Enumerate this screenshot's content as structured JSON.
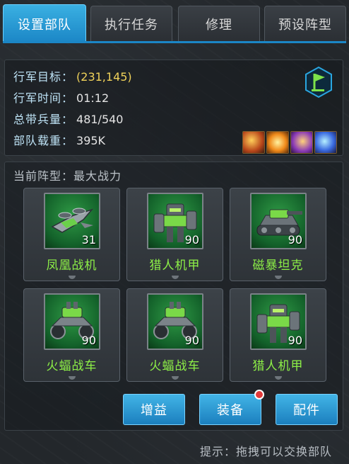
{
  "tabs": [
    {
      "label": "设置部队",
      "active": true
    },
    {
      "label": "执行任务",
      "active": false
    },
    {
      "label": "修理",
      "active": false
    },
    {
      "label": "预设阵型",
      "active": false
    }
  ],
  "info": {
    "target_label": "行军目标：",
    "target_value": "(231,145)",
    "time_label": "行军时间：",
    "time_value": "01:12",
    "troops_label": "总带兵量：",
    "troops_value": "481/540",
    "load_label": "部队载重：",
    "load_value": "395K"
  },
  "formation": {
    "title": "当前阵型：最大战力",
    "units": [
      {
        "name": "凤凰战机",
        "level": "31",
        "icon": "fighter-jet-icon"
      },
      {
        "name": "猎人机甲",
        "level": "90",
        "icon": "mech-icon"
      },
      {
        "name": "磁暴坦克",
        "level": "90",
        "icon": "tank-icon"
      },
      {
        "name": "火蝠战车",
        "level": "90",
        "icon": "buggy-icon"
      },
      {
        "name": "火蝠战车",
        "level": "90",
        "icon": "buggy-icon"
      },
      {
        "name": "猎人机甲",
        "level": "90",
        "icon": "mech-icon"
      }
    ]
  },
  "buttons": {
    "buff": "增益",
    "equip": "装备",
    "parts": "配件"
  },
  "hint": "提示：拖拽可以交换部队",
  "colors": {
    "accent": "#1b86c6",
    "unit_name": "#8df047",
    "gold": "#f0d25a"
  }
}
